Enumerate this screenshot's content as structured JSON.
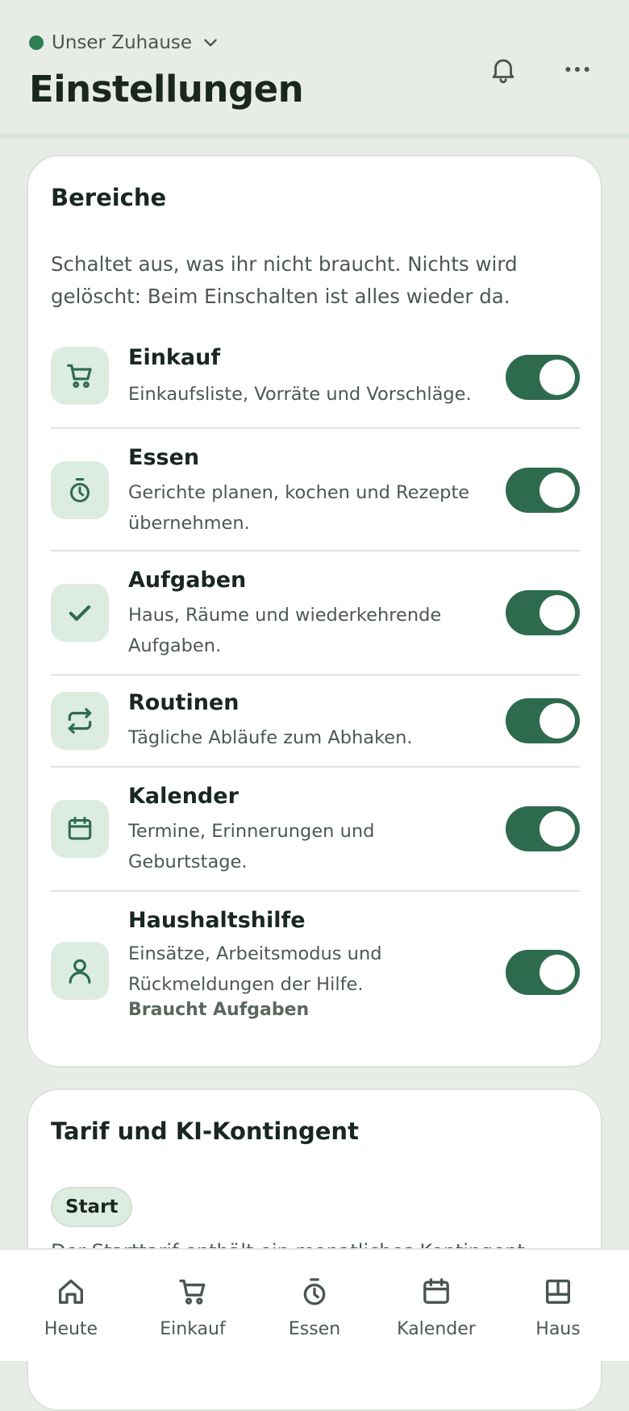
{
  "colors": {
    "accent": "#2e6b4e",
    "tile_bg": "#dcece1",
    "status_dot": "#2e7d55",
    "icon_dark": "#4a554f"
  },
  "header": {
    "household": "Unser Zuhause",
    "title": "Einstellungen",
    "bell_icon": "bell-icon",
    "more_icon": "more-icon"
  },
  "areas": {
    "title": "Bereiche",
    "intro": "Schaltet aus, was ihr nicht braucht. Nichts wird gelöscht: Beim Einschalten ist alles wieder da.",
    "items": [
      {
        "icon": "cart-icon",
        "title": "Einkauf",
        "desc": "Einkaufsliste, Vorräte und Vorschläge.",
        "enabled": true
      },
      {
        "icon": "timer-icon",
        "title": "Essen",
        "desc": "Gerichte planen, kochen und Rezepte übernehmen.",
        "enabled": true
      },
      {
        "icon": "check-icon",
        "title": "Aufgaben",
        "desc": "Haus, Räume und wiederkehrende Aufgaben.",
        "enabled": true
      },
      {
        "icon": "repeat-icon",
        "title": "Routinen",
        "desc": "Tägliche Abläufe zum Abhaken.",
        "enabled": true
      },
      {
        "icon": "calendar-icon",
        "title": "Kalender",
        "desc": "Termine, Erinnerungen und Geburtstage.",
        "enabled": true
      },
      {
        "icon": "person-icon",
        "title": "Haushaltshilfe",
        "desc": "Einsätze, Arbeitsmodus und Rückmeldungen der Hilfe.",
        "dependency": "Braucht Aufgaben",
        "enabled": true
      }
    ]
  },
  "plan": {
    "title": "Tarif und KI-Kontingent",
    "badge": "Start",
    "text": "Der Starttarif enthält ein monatliches Kontingent"
  },
  "tabs": [
    {
      "label": "Heute",
      "icon": "home-icon"
    },
    {
      "label": "Einkauf",
      "icon": "cart-icon"
    },
    {
      "label": "Essen",
      "icon": "timer-icon"
    },
    {
      "label": "Kalender",
      "icon": "calendar-icon"
    },
    {
      "label": "Haus",
      "icon": "layout-icon"
    }
  ]
}
